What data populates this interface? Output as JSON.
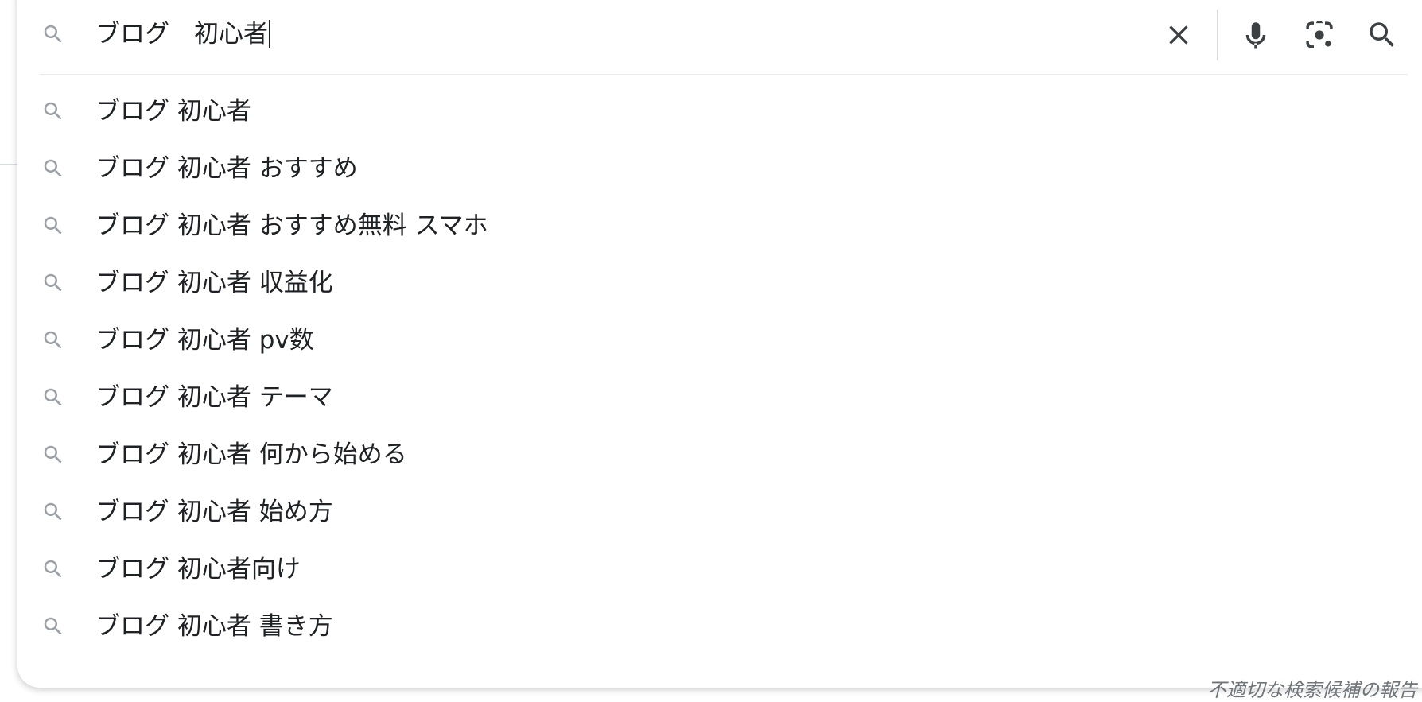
{
  "search": {
    "query": "ブログ　初心者",
    "clear_label": "Clear",
    "voice_label": "Voice search",
    "lens_label": "Search by image",
    "submit_label": "Search"
  },
  "suggestions": [
    "ブログ 初心者",
    "ブログ 初心者 おすすめ",
    "ブログ 初心者 おすすめ無料 スマホ",
    "ブログ 初心者 収益化",
    "ブログ 初心者 pv数",
    "ブログ 初心者 テーマ",
    "ブログ 初心者 何から始める",
    "ブログ 初心者 始め方",
    "ブログ 初心者向け",
    "ブログ 初心者 書き方"
  ],
  "footer": {
    "report_label": "不適切な検索候補の報告"
  },
  "colors": {
    "icon_gray": "#9aa0a6",
    "dark_icon": "#3c4043",
    "text": "#202124"
  },
  "icons": {
    "search": "search-icon",
    "clear": "close-icon",
    "voice": "microphone-icon",
    "lens": "camera-lens-icon",
    "submit": "search-icon"
  }
}
